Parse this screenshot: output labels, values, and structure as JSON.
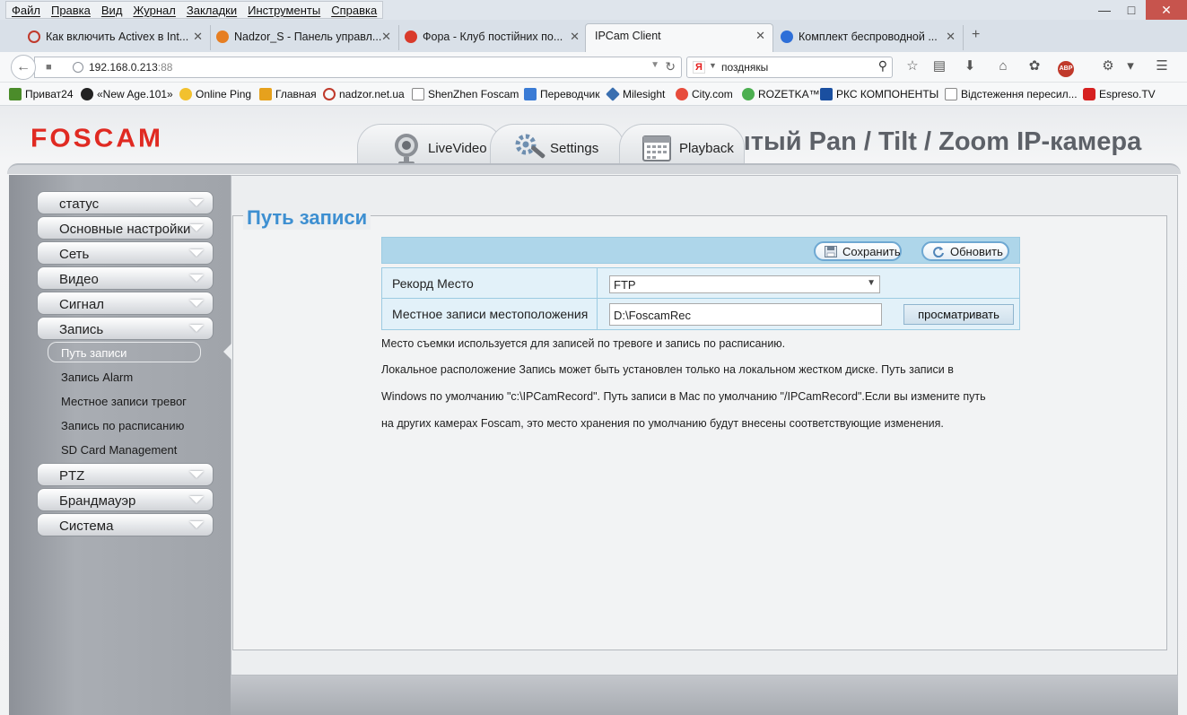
{
  "browser": {
    "menu": [
      "Файл",
      "Правка",
      "Вид",
      "Журнал",
      "Закладки",
      "Инструменты",
      "Справка"
    ],
    "tabs": [
      {
        "title": "Как включить Activex в Int...",
        "color": "#c0392b"
      },
      {
        "title": "Nadzor_S - Панель управл...",
        "color": "#e67e22"
      },
      {
        "title": "Фора - Клуб постійних по...",
        "color": "#d93a2b"
      },
      {
        "title": "IPCam Client",
        "color": ""
      },
      {
        "title": "Комплект беспроводной ...",
        "color": "#2e6fd8"
      }
    ],
    "address": {
      "host": "192.168.0.213",
      "port": ":88"
    },
    "search": {
      "engine": "Я",
      "query": "позднякы"
    },
    "bookmarks": [
      {
        "label": "Приват24",
        "color": "#4b8c2a"
      },
      {
        "label": "«New Age.101»",
        "color": "#222222"
      },
      {
        "label": "Online Ping",
        "color": "#f2c12e"
      },
      {
        "label": "Главная",
        "color": "#e6a11d"
      },
      {
        "label": "nadzor.net.ua",
        "color": "#c0392b"
      },
      {
        "label": "ShenZhen Foscam",
        "color": "#ffffff"
      },
      {
        "label": "Переводчик",
        "color": "#3a7bd5"
      },
      {
        "label": "Milesight",
        "color": "#3a6fb0"
      },
      {
        "label": "City.com",
        "color": "#e74c3c"
      },
      {
        "label": "ROZETKA™",
        "color": "#4caf50"
      },
      {
        "label": "РКС КОМПОНЕНТЫ",
        "color": "#1a4fa0"
      },
      {
        "label": "Відстеження пересил...",
        "color": "#ffffff"
      },
      {
        "label": "Espreso.TV",
        "color": "#d62020"
      }
    ]
  },
  "app": {
    "logo": "FOSCAM",
    "header_title": "ытый Pan / Tilt / Zoom IP-камера",
    "nav_tabs": {
      "live": "LiveVideo",
      "settings": "Settings",
      "playback": "Playback"
    }
  },
  "sidebar": {
    "groups_top": [
      "статус",
      "Основные настройки",
      "Сеть",
      "Видео",
      "Сигнал",
      "Запись"
    ],
    "submenu": [
      "Путь записи",
      "Запись Alarm",
      "Местное записи тревог",
      "Запись по расписанию",
      "SD Card Management"
    ],
    "groups_bottom": [
      "PTZ",
      "Брандмауэр",
      "Система"
    ]
  },
  "content": {
    "title": "Путь записи",
    "save_label": "Сохранить",
    "refresh_label": "Обновить",
    "fields": {
      "location_label": "Рекорд Место",
      "location_value": "FTP",
      "local_path_label": "Местное записи местоположения",
      "local_path_value": "D:\\FoscamRec",
      "browse_label": "просматривать"
    },
    "help": [
      "Место съемки используется для записей по тревоге и запись по расписанию.",
      "Локальное расположение Запись может быть установлен только на локальном жестком диске. Путь записи в",
      "Windows по умолчанию \"c:\\IPCamRecord\". Путь записи в Mac по умолчанию \"/IPCamRecord\".Если вы измените путь",
      "на других камерах Foscam, это место хранения по умолчанию будут внесены соответствующие изменения."
    ]
  }
}
